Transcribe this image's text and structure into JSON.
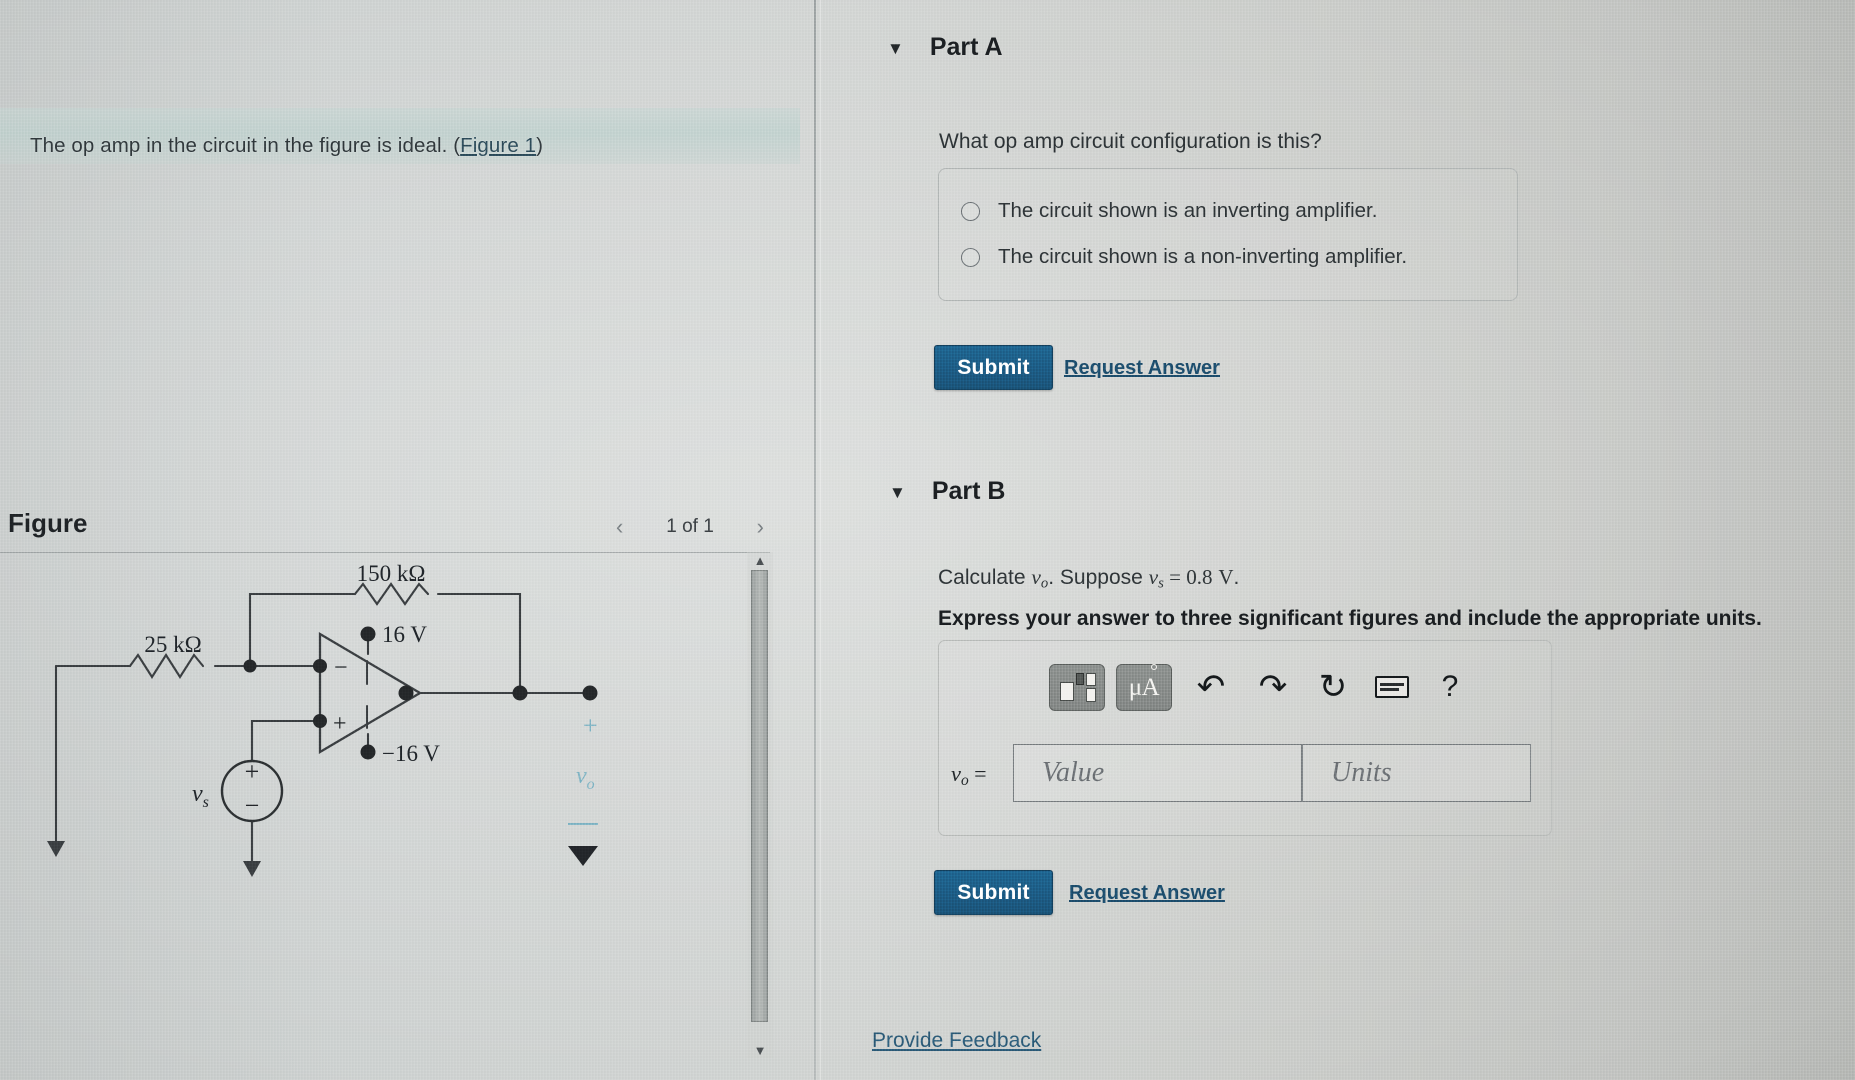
{
  "problem": {
    "statement_text": "The op amp in the circuit in the figure is ideal. (",
    "figure_link": "Figure 1",
    "statement_close": ")"
  },
  "figure_panel": {
    "title": "Figure",
    "prev_arrow": "‹",
    "page_count": "1 of 1",
    "next_arrow": "›",
    "scroll_up": "▲",
    "scroll_down": "▼"
  },
  "circuit": {
    "feedback_resistor": "150 kΩ",
    "input_resistor": "25 kΩ",
    "supply_positive": "16 V",
    "supply_negative": "−16 V",
    "opamp_minus": "−",
    "opamp_plus": "+",
    "source_label": "v",
    "source_sub": "s",
    "source_plus": "+",
    "source_minus": "−",
    "output_plus": "+",
    "output_label": "v",
    "output_sub": "o"
  },
  "partA": {
    "caret": "▼",
    "label": "Part A",
    "question": "What op amp circuit configuration is this?",
    "choices": [
      "The circuit shown is an inverting amplifier.",
      "The circuit shown is a non-inverting amplifier."
    ],
    "submit_label": "Submit",
    "request_answer_label": "Request Answer"
  },
  "partB": {
    "caret": "▼",
    "label": "Part B",
    "prompt_prefix": "Calculate ",
    "prompt_var": "v",
    "prompt_var_sub": "o",
    "prompt_mid": ". Suppose ",
    "prompt_var2": "v",
    "prompt_var2_sub": "s",
    "prompt_equals": " = 0.8",
    "prompt_unit": "V",
    "prompt_suffix": ".",
    "note": "Express your answer to three significant figures and include the appropriate units.",
    "answer_label_var": "v",
    "answer_label_sub": "o",
    "answer_label_eq": " =",
    "value_placeholder": "Value",
    "units_placeholder": "Units",
    "submit_label": "Submit",
    "request_answer_label": "Request Answer",
    "toolbar": {
      "template_icon": "math-template-icon",
      "unit_icon": "μA",
      "undo_icon": "↶",
      "redo_icon": "↷",
      "reset_icon": "↻",
      "keyboard_icon": "keyboard-icon",
      "help_icon": "?"
    }
  },
  "footer": {
    "provide_feedback": "Provide Feedback"
  },
  "colors": {
    "submit_blue": "#1d5d86",
    "link_blue": "#1d4e6e",
    "screen_gray": "#c9ccc9",
    "annotation_blue": "#7fb4c4"
  }
}
